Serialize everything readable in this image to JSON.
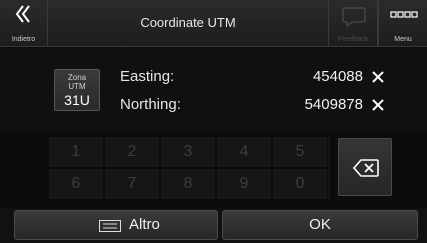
{
  "header": {
    "back_label": "Indietro",
    "title": "Coordinate UTM",
    "feedback_label": "Feedback",
    "menu_label": "Menu"
  },
  "coordinates": {
    "zone_label_line1": "Zona",
    "zone_label_line2": "UTM",
    "zone_value": "31U",
    "easting_label": "Easting:",
    "easting_value": "454088",
    "northing_label": "Northing:",
    "northing_value": "5409878"
  },
  "keypad": {
    "row1": [
      "1",
      "2",
      "3",
      "4",
      "5"
    ],
    "row2": [
      "6",
      "7",
      "8",
      "9",
      "0"
    ]
  },
  "footer": {
    "more_label": "Altro",
    "ok_label": "OK"
  },
  "colors": {
    "background": "#0c0c0c",
    "disabled_key_text": "#3d3d3d"
  }
}
